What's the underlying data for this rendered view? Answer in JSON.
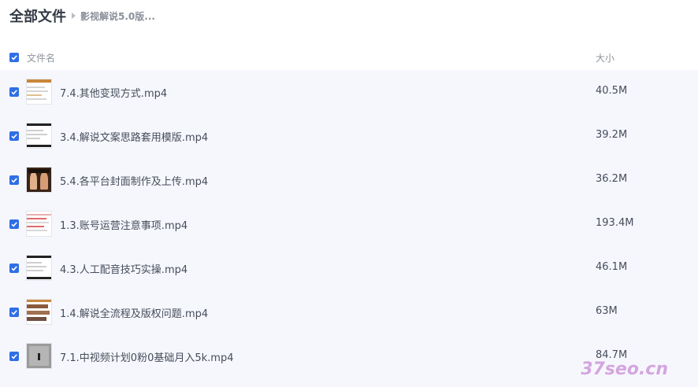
{
  "header": {
    "title": "全部文件",
    "breadcrumb": "影视解说5.0版..."
  },
  "columns": {
    "name": "文件名",
    "size": "大小"
  },
  "files": [
    {
      "name": "7.4.其他变现方式.mp4",
      "size": "40.5M",
      "thumb": "doc-orange"
    },
    {
      "name": "3.4.解说文案思路套用模版.mp4",
      "size": "39.2M",
      "thumb": "doc-dark"
    },
    {
      "name": "5.4.各平台封面制作及上传.mp4",
      "size": "36.2M",
      "thumb": "photo"
    },
    {
      "name": "1.3.账号运营注意事项.mp4",
      "size": "193.4M",
      "thumb": "doc-red"
    },
    {
      "name": "4.3.人工配音技巧实操.mp4",
      "size": "46.1M",
      "thumb": "doc-dark"
    },
    {
      "name": "1.4.解说全流程及版权问题.mp4",
      "size": "63M",
      "thumb": "doc-grid"
    },
    {
      "name": "7.1.中视频计划0粉0基础月入5k.mp4",
      "size": "84.7M",
      "thumb": "screen-gray"
    }
  ],
  "watermark": "37seo.cn",
  "colors": {
    "checkbox": "#2f6ee6",
    "list_bg": "#f6f7fd"
  }
}
